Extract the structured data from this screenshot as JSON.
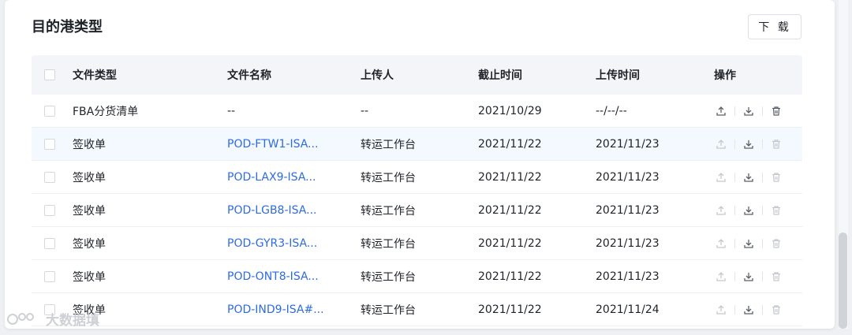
{
  "section": {
    "title": "目的港类型",
    "download_label": "下 载"
  },
  "table": {
    "headers": [
      "文件类型",
      "文件名称",
      "上传人",
      "截止时间",
      "上传时间",
      "操作"
    ],
    "rows": [
      {
        "type": "FBA分货清单",
        "name": "--",
        "name_is_link": false,
        "uploader": "--",
        "deadline": "2021/10/29",
        "uploaded": "--/--/--",
        "upload_enabled": true,
        "delete_enabled": true
      },
      {
        "type": "签收单",
        "name": "POD-FTW1-ISA...",
        "name_is_link": true,
        "uploader": "转运工作台",
        "deadline": "2021/11/22",
        "uploaded": "2021/11/23",
        "upload_enabled": false,
        "delete_enabled": false
      },
      {
        "type": "签收单",
        "name": "POD-LAX9-ISA...",
        "name_is_link": true,
        "uploader": "转运工作台",
        "deadline": "2021/11/22",
        "uploaded": "2021/11/23",
        "upload_enabled": false,
        "delete_enabled": false
      },
      {
        "type": "签收单",
        "name": "POD-LGB8-ISA...",
        "name_is_link": true,
        "uploader": "转运工作台",
        "deadline": "2021/11/22",
        "uploaded": "2021/11/23",
        "upload_enabled": false,
        "delete_enabled": false
      },
      {
        "type": "签收单",
        "name": "POD-GYR3-ISA...",
        "name_is_link": true,
        "uploader": "转运工作台",
        "deadline": "2021/11/22",
        "uploaded": "2021/11/23",
        "upload_enabled": false,
        "delete_enabled": false
      },
      {
        "type": "签收单",
        "name": "POD-ONT8-ISA...",
        "name_is_link": true,
        "uploader": "转运工作台",
        "deadline": "2021/11/22",
        "uploaded": "2021/11/23",
        "upload_enabled": false,
        "delete_enabled": false
      },
      {
        "type": "签收单",
        "name": "POD-IND9-ISA#...",
        "name_is_link": true,
        "uploader": "转运工作台",
        "deadline": "2021/11/22",
        "uploaded": "2021/11/24",
        "upload_enabled": false,
        "delete_enabled": false
      }
    ]
  },
  "watermark": {
    "text": "大数据填"
  },
  "colors": {
    "link": "#2d6be4",
    "header_bg": "#f3f5f8",
    "icon_enabled": "#5a5f66",
    "icon_disabled": "#c5c8cd"
  }
}
